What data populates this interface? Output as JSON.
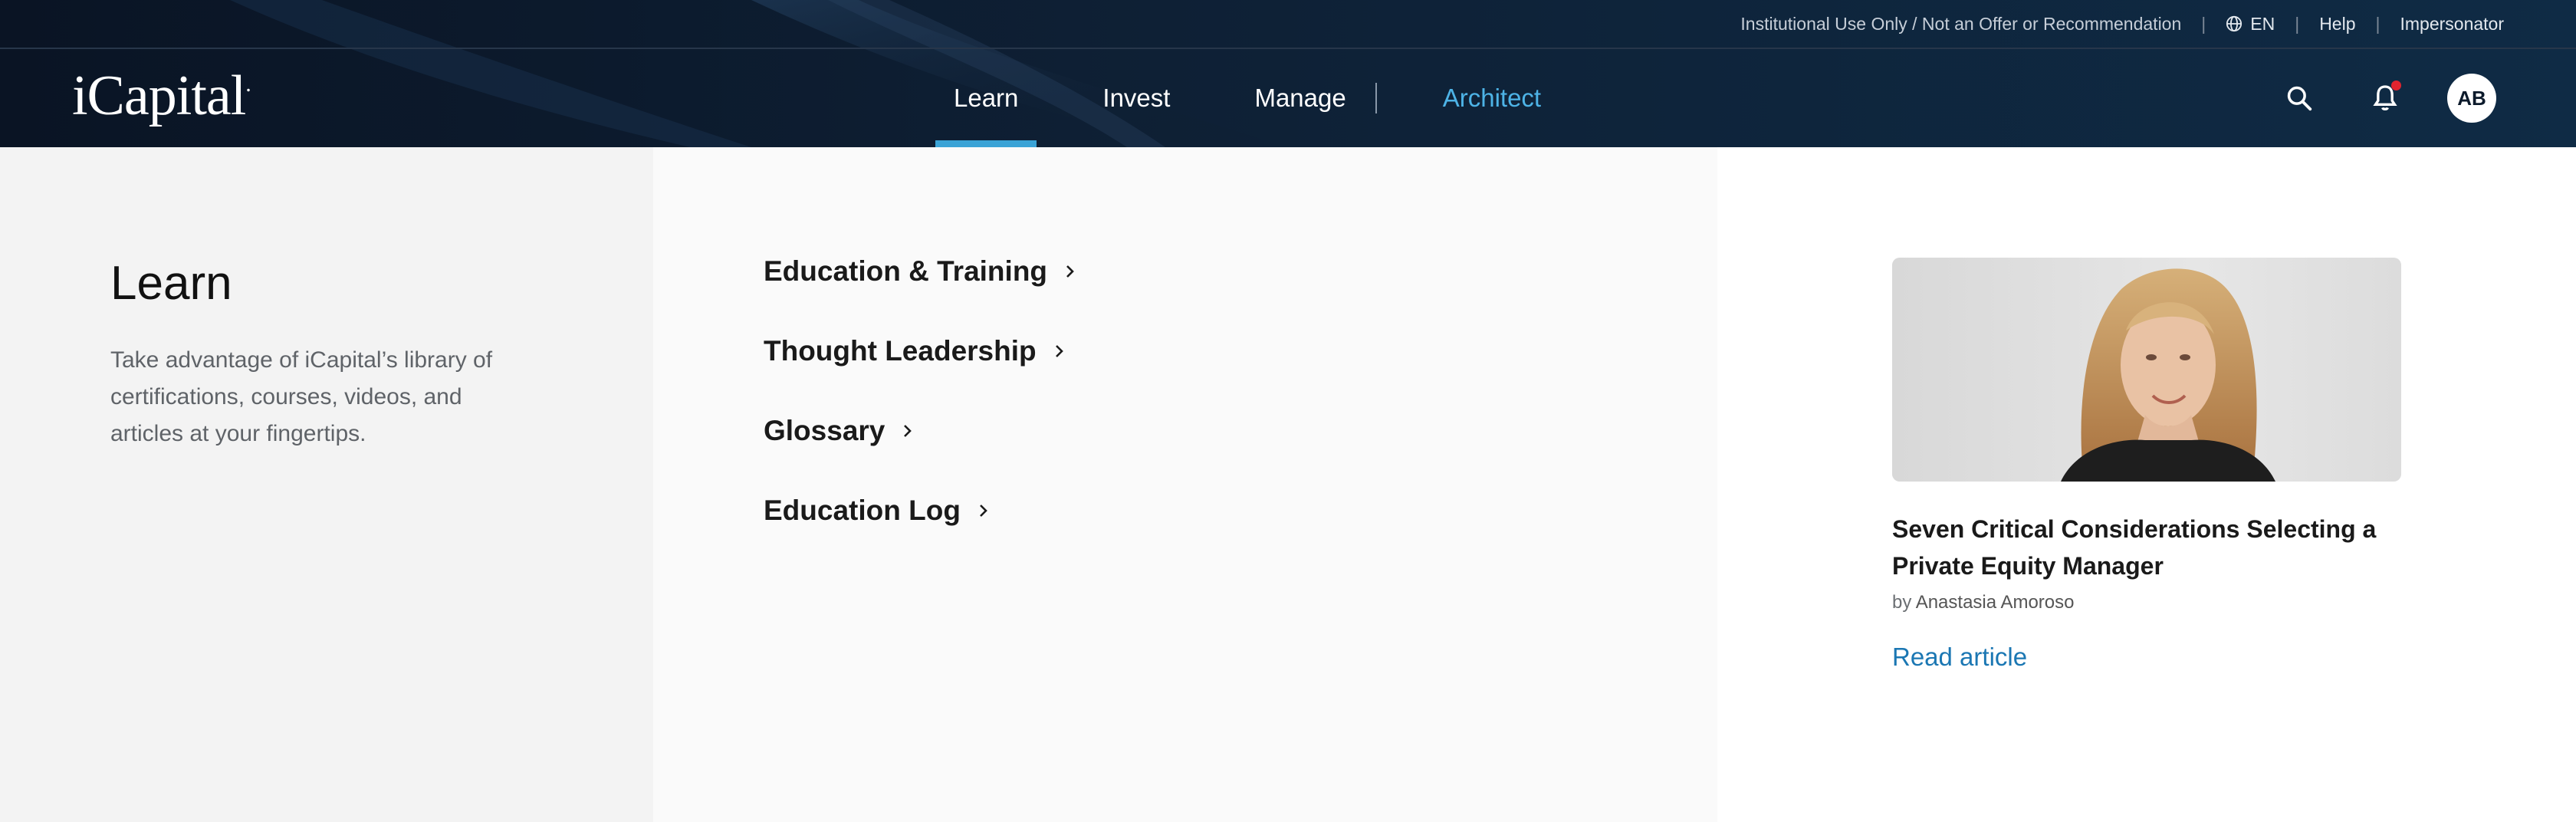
{
  "topbar": {
    "disclaimer": "Institutional Use Only / Not an Offer or Recommendation",
    "language": "EN",
    "help": "Help",
    "user_label": "Impersonator",
    "globe_icon": "globe-icon"
  },
  "brand": {
    "logo_text": "iCapital",
    "logo_dot": "."
  },
  "nav": {
    "items": [
      {
        "label": "Learn",
        "active": true
      },
      {
        "label": "Invest"
      },
      {
        "label": "Manage"
      }
    ],
    "architect": "Architect"
  },
  "actions": {
    "search_icon": "search-icon",
    "bell_icon": "bell-icon",
    "avatar_initials": "AB"
  },
  "menu": {
    "title": "Learn",
    "description": "Take advantage of iCapital’s library of certifications, courses, videos, and articles at your fingertips.",
    "links": [
      {
        "label": "Education & Training"
      },
      {
        "label": "Thought Leadership"
      },
      {
        "label": "Glossary"
      },
      {
        "label": "Education Log"
      }
    ]
  },
  "featured": {
    "title": "Seven Critical Considerations Selecting a Private Equity Manager",
    "by": "by",
    "author": "Anastasia Amoroso",
    "read_link": "Read article"
  },
  "colors": {
    "header_bg": "#0c1a2b",
    "accent": "#3aa3d6",
    "architect": "#4db3e6",
    "link": "#1b77b3",
    "notification": "#e0242f"
  }
}
